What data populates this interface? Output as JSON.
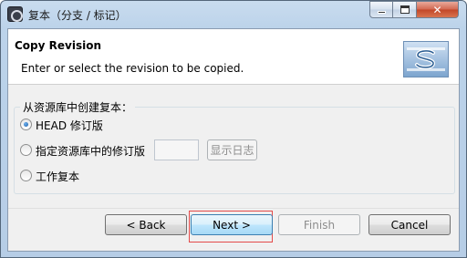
{
  "window": {
    "title": "复本（分支 / 标记）",
    "controls": {
      "minimize": "minimize",
      "maximize": "maximize",
      "close": "✕"
    }
  },
  "header": {
    "title": "Copy Revision",
    "description": "Enter or select the revision to be copied.",
    "logo_icon": "subversion-logo-icon"
  },
  "group": {
    "label": "从资源库中创建复本：",
    "options": [
      {
        "label": "HEAD 修订版",
        "checked": true
      },
      {
        "label": "指定资源库中的修订版",
        "checked": false
      },
      {
        "label": "工作复本",
        "checked": false
      }
    ],
    "revision_value": "",
    "show_log_label": "显示日志"
  },
  "buttons": {
    "back": "< Back",
    "next": "Next >",
    "finish": "Finish",
    "cancel": "Cancel"
  },
  "colors": {
    "accent": "#3c7fb1",
    "focus_outline": "#e34a4a",
    "close_button": "#c24628"
  }
}
